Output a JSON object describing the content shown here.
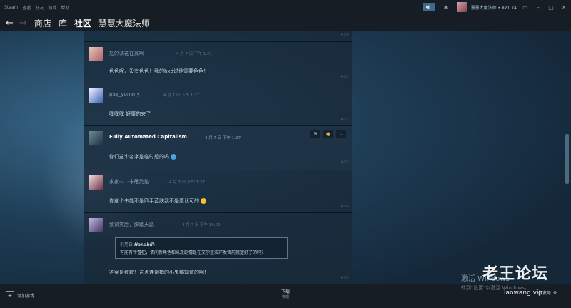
{
  "menubar": {
    "items": [
      "Steam",
      "查看",
      "好友",
      "游戏",
      "帮助"
    ],
    "account_label": "慧慧大魔法师 • ¥21.74"
  },
  "nav": {
    "back_glyph": "←",
    "forward_glyph": "→",
    "items": [
      "商店",
      "库",
      "社区",
      "慧慧大魔法师"
    ]
  },
  "thread": {
    "top_number": "#50",
    "posts": [
      {
        "author": "怒的骑花在冀啊",
        "meta": "4 月 7 日 下午 1:21",
        "body": "色色呢，没有色色！我的hxd说他需要色色！",
        "number": "#52"
      },
      {
        "author": "pay_yummy",
        "meta": "4 月 7 日 下午 1:27",
        "body": "嘿嘿嘿 好康的来了",
        "number": "#52"
      },
      {
        "author": "Fully Automated Capitalism",
        "meta": "4 月 7 日 下午 1:27",
        "body": "你们这个名字是临时想的吗",
        "number": "#53"
      },
      {
        "author": "永夜-21-卡眠烈焰",
        "meta": "4 月 7 日 下午 1:27",
        "body": "你这个书能不是四手蓝肤我不是原认可的",
        "number": "#54"
      },
      {
        "author": "致调笑脸，脚踏天路",
        "meta": "4 月 7 日 下午 10:00",
        "quote_prefix": "引用自",
        "quote_author": "Hanabill",
        "quote_text": "可能有所冒犯，请问新角色和以及剧情是在艾尔登法环发售前就定好了的吗?",
        "body": "答案是致歉！这点连谢指的小鬼都知道的啊!",
        "number": "#55"
      }
    ]
  },
  "bottombar": {
    "add_game_label": "添加游戏",
    "download_label": "下载",
    "download_sub": "管理",
    "friends_label": "好友与"
  },
  "overlay": {
    "activate_title": "激活 Windows",
    "activate_sub": "转到\"设置\"以激活 Windows。",
    "watermark": "老王论坛",
    "watermark_url": "laowang.vip"
  },
  "colors": {
    "menubar": "#171d25",
    "accent_green": "#5c7e10",
    "background": "#1b2838"
  }
}
